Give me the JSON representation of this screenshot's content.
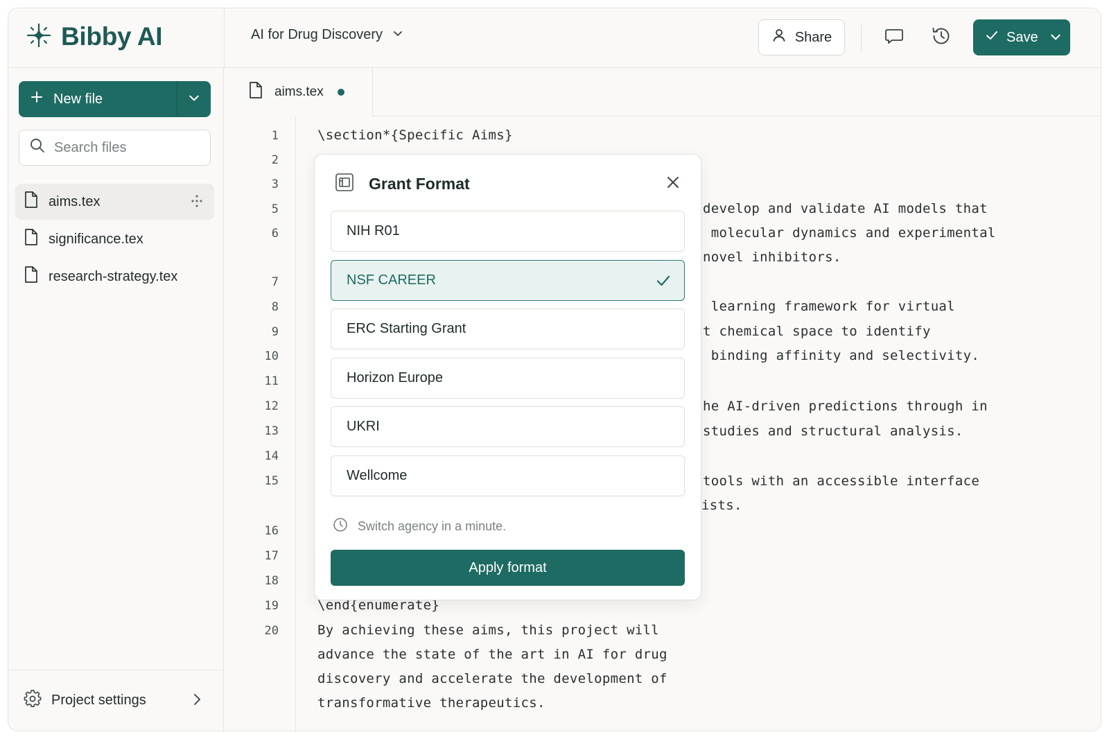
{
  "app": {
    "name": "Bibby AI",
    "brand_color": "#1e6b63"
  },
  "header": {
    "project_name": "AI for Drug Discovery",
    "share_label": "Share",
    "save_label": "Save"
  },
  "sidebar": {
    "new_file_label": "New file",
    "search_placeholder": "Search files",
    "files": [
      {
        "name": "aims.tex",
        "active": true
      },
      {
        "name": "significance.tex",
        "active": false
      },
      {
        "name": "research-strategy.tex",
        "active": false
      }
    ],
    "settings_label": "Project settings"
  },
  "editor": {
    "tab": {
      "name": "aims.tex",
      "unsaved": true
    },
    "line_numbers": [
      "1",
      "2",
      "3",
      "5",
      "6",
      "7",
      "8",
      "9",
      "10",
      "11",
      "12",
      "13",
      "14",
      "15",
      "16",
      "17",
      "18",
      "19",
      "20"
    ],
    "lines": {
      "l1": "\\section*{Specific Aims}",
      "l5": "develop and validate AI models that",
      "l6": " molecular dynamics and experimental",
      "l6b": "novel inhibitors.",
      "l8": " learning framework for virtual",
      "l9": "t chemical space to identify",
      "l10": " binding affinity and selectivity.",
      "l12": "he AI-driven predictions through in",
      "l13": "studies and structural analysis.",
      "l15": "tools with an accessible interface",
      "l15b": "ists.",
      "l19": "\\end{enumerate}",
      "l20a": "By achieving these aims, this project will",
      "l20b": "advance the state of the art in AI for drug",
      "l20c": "discovery and accelerate the development of",
      "l20d": "transformative therapeutics."
    }
  },
  "grant_format": {
    "title": "Grant Format",
    "options": [
      {
        "label": "NIH R01",
        "selected": false
      },
      {
        "label": "NSF CAREER",
        "selected": true
      },
      {
        "label": "ERC Starting Grant",
        "selected": false
      },
      {
        "label": "Horizon Europe",
        "selected": false
      },
      {
        "label": "UKRI",
        "selected": false
      },
      {
        "label": "Wellcome",
        "selected": false
      }
    ],
    "hint": "Switch agency in a minute.",
    "apply_label": "Apply format"
  }
}
